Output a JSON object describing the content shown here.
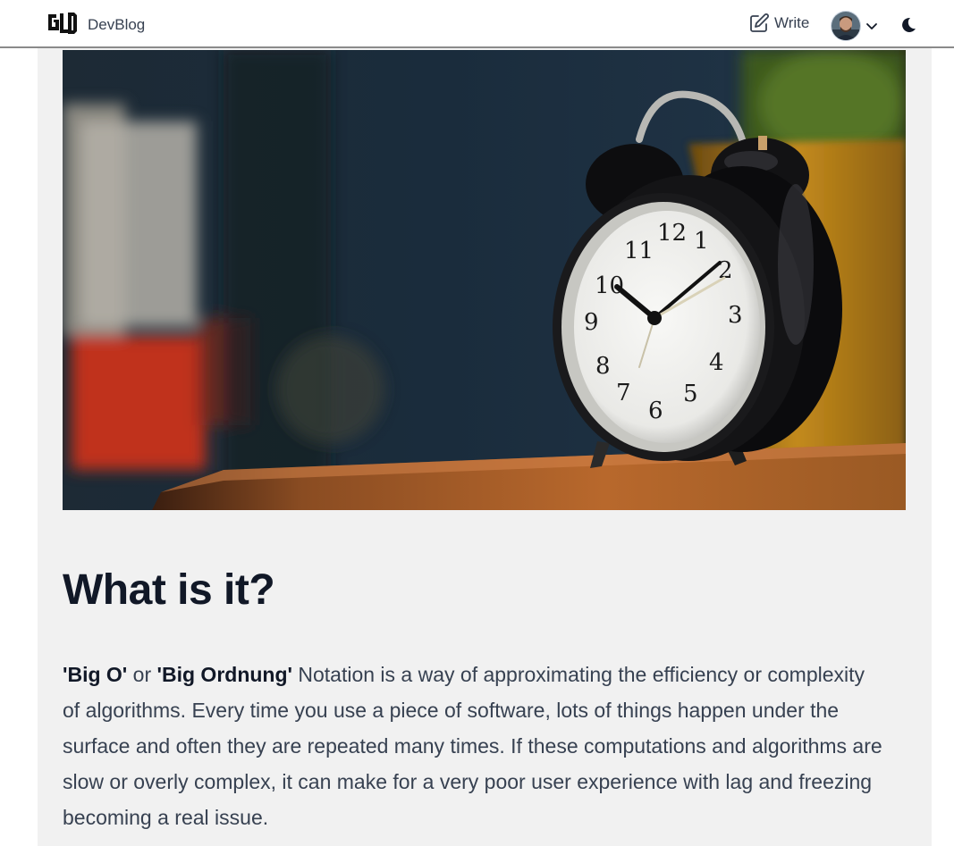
{
  "header": {
    "logo_text": "GLD",
    "brand_name": "DevBlog",
    "write_label": "Write",
    "icons": {
      "write": "edit-icon",
      "menu": "chevron-down-icon",
      "theme": "moon-icon"
    }
  },
  "hero_image": {
    "subject": "black alarm clock on wooden table",
    "clock_numerals": [
      "12",
      "1",
      "2",
      "3",
      "4",
      "5",
      "6",
      "7",
      "8",
      "9",
      "10",
      "11"
    ]
  },
  "article": {
    "heading": "What is it?",
    "bold_1": "'Big O'",
    "connector": " or ",
    "bold_2": "'Big Ordnung'",
    "body": " Notation is a way of approximating the efficiency or complexity of algorithms. Every time you use a piece of software, lots of things happen under the surface and often they are repeated many times. If these computations and algorithms are slow or overly complex, it can make for a very poor user experience with lag and freezing becoming a real issue."
  },
  "colors": {
    "page_background": "#f1f1f1",
    "heading": "#111827",
    "body_text": "#374151",
    "header_border": "#8a8a8a"
  }
}
